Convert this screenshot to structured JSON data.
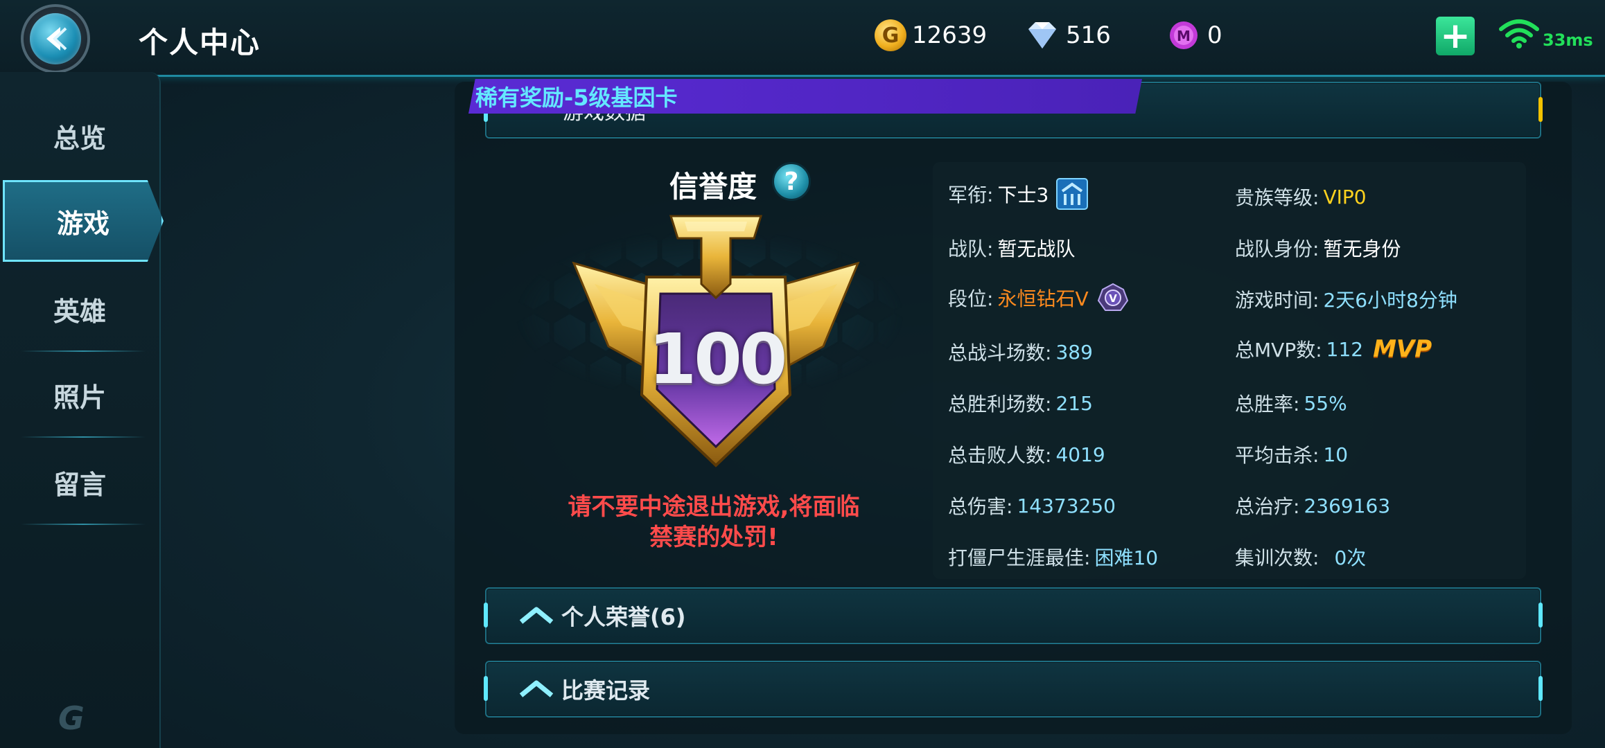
{
  "header": {
    "title": "个人中心",
    "gold": "12639",
    "diamonds": "516",
    "gems": "0",
    "ping": "33ms"
  },
  "sidebar": {
    "items": [
      {
        "label": "总览"
      },
      {
        "label": "游戏"
      },
      {
        "label": "英雄"
      },
      {
        "label": "照片"
      },
      {
        "label": "留言"
      }
    ],
    "active_index": 1
  },
  "panel": {
    "reward_banner": "稀有奖励-5级基因卡",
    "game_data_label": "游戏数据",
    "credit": {
      "title": "信誉度",
      "score": "100",
      "warning_line1": "请不要中途退出游戏,将面临",
      "warning_line2": "禁赛的处罚!"
    },
    "stats": {
      "military_rank_label": "军衔:",
      "military_rank_value": "下士3",
      "noble_label": "贵族等级:",
      "noble_value": "VIP0",
      "team_label": "战队:",
      "team_value": "暂无战队",
      "team_role_label": "战队身份:",
      "team_role_value": "暂无身份",
      "tier_label": "段位:",
      "tier_value": "永恒钻石V",
      "playtime_label": "游戏时间:",
      "playtime_value": "2天6小时8分钟",
      "matches_label": "总战斗场数:",
      "matches_value": "389",
      "mvp_label": "总MVP数:",
      "mvp_value": "112",
      "mvp_badge": "MVP",
      "wins_label": "总胜利场数:",
      "wins_value": "215",
      "winrate_label": "总胜率:",
      "winrate_value": "55%",
      "kills_label": "总击败人数:",
      "kills_value": "4019",
      "avg_kills_label": "平均击杀:",
      "avg_kills_value": "10",
      "damage_label": "总伤害:",
      "damage_value": "14373250",
      "heal_label": "总治疗:",
      "heal_value": "2369163",
      "zombie_label": "打僵尸生涯最佳:",
      "zombie_value": "困难10",
      "training_label": "集训次数:",
      "training_value": "0次"
    },
    "honors_label": "个人荣誉(6)",
    "match_record_label": "比赛记录"
  },
  "colors": {
    "accent_cyan": "#5fe8ff",
    "warning_red": "#ff4b4b",
    "tier_orange": "#ff8a1e",
    "vip_yellow": "#ffd21e",
    "value_cyan": "#8fe0ff"
  },
  "icons": {
    "back": "back-arrow-icon",
    "gold": "gold-coin-icon",
    "diamond": "diamond-icon",
    "gem": "purple-gem-icon",
    "add": "plus-icon",
    "wifi": "wifi-icon",
    "help": "question-icon"
  }
}
